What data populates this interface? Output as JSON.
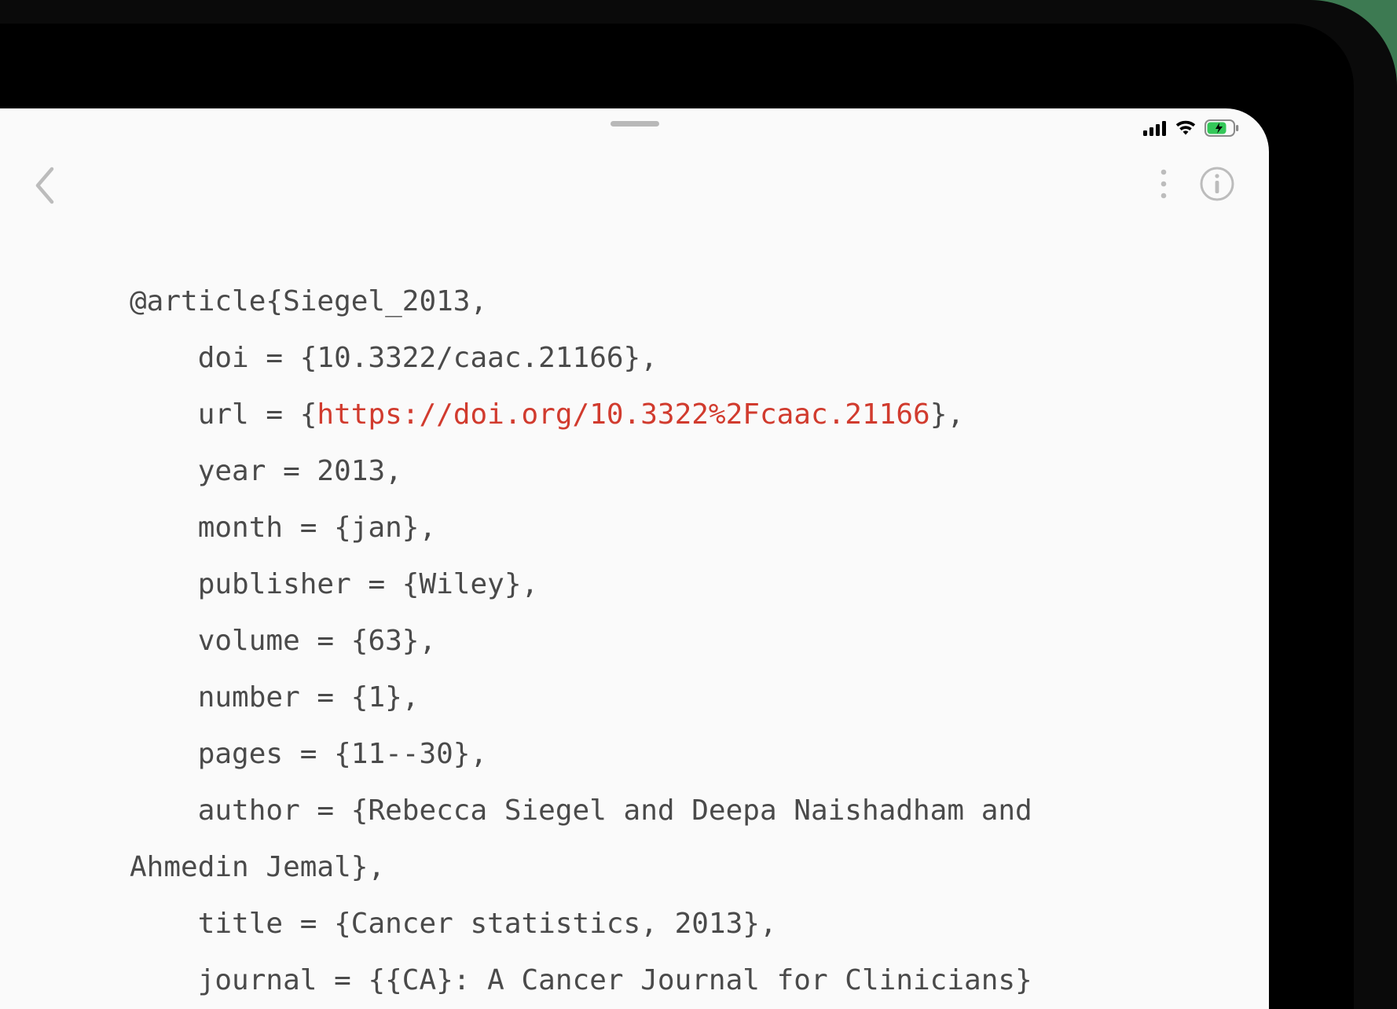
{
  "bibtex": {
    "entry_type": "@article",
    "cite_key": "Siegel_2013",
    "open": "@article{Siegel_2013,",
    "fields": {
      "doi": {
        "key": "doi",
        "raw": "    doi = {10.3322/caac.21166},"
      },
      "url": {
        "key": "url",
        "prefix": "    url = {",
        "link": "https://doi.org/10.3322%2Fcaac.21166",
        "suffix": "},"
      },
      "year": {
        "key": "year",
        "raw": "    year = 2013,"
      },
      "month": {
        "key": "month",
        "raw": "    month = {jan},"
      },
      "publisher": {
        "key": "publisher",
        "raw": "    publisher = {Wiley},"
      },
      "volume": {
        "key": "volume",
        "raw": "    volume = {63},"
      },
      "number": {
        "key": "number",
        "raw": "    number = {1},"
      },
      "pages": {
        "key": "pages",
        "raw": "    pages = {11--30},"
      },
      "author": {
        "key": "author",
        "raw": "    author = {Rebecca Siegel and Deepa Naishadham and Ahmedin Jemal},"
      },
      "title": {
        "key": "title",
        "raw": "    title = {Cancer statistics, 2013},"
      },
      "journal": {
        "key": "journal",
        "raw": "    journal = {{CA}: A Cancer Journal for Clinicians}"
      }
    }
  }
}
